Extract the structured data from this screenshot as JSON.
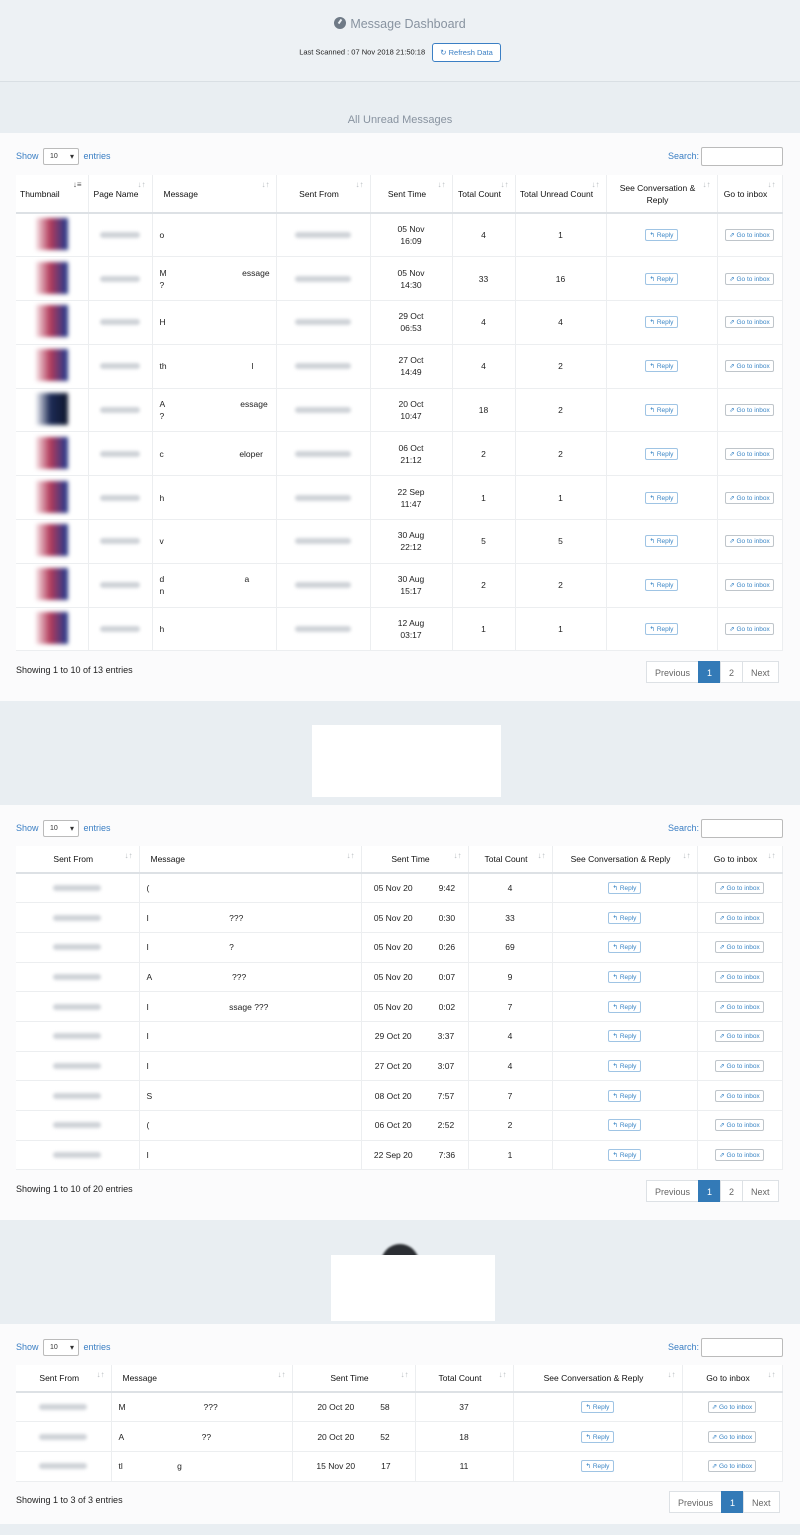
{
  "header": {
    "title": "Message Dashboard",
    "last_scanned": "Last Scanned : 07 Nov 2018 21:50:18",
    "refresh_label": "Refresh Data"
  },
  "section1_title": "All Unread Messages",
  "controls": {
    "show": "Show",
    "entries": "entries",
    "page_length": "10",
    "search_label": "Search:"
  },
  "table1": {
    "headers": [
      "Thumbnail",
      "Page Name",
      "Message",
      "Sent From",
      "Sent Time",
      "Total Count",
      "Total Unread Count",
      "See Conversation & Reply",
      "Go to inbox"
    ],
    "rows": [
      {
        "msg": "o",
        "time": "05 Nov\n16:09",
        "total": "4",
        "unread": "1"
      },
      {
        "msg": "M                                essage\n?",
        "time": "05 Nov\n14:30",
        "total": "33",
        "unread": "16"
      },
      {
        "msg": "H",
        "time": "29 Oct\n06:53",
        "total": "4",
        "unread": "4"
      },
      {
        "msg": "th                                    l",
        "time": "27 Oct\n14:49",
        "total": "4",
        "unread": "2"
      },
      {
        "msg": "A                                essage\n?",
        "time": "20 Oct\n10:47",
        "total": "18",
        "unread": "2"
      },
      {
        "msg": "c                                eloper",
        "time": "06 Oct\n21:12",
        "total": "2",
        "unread": "2"
      },
      {
        "msg": "h",
        "time": "22 Sep\n11:47",
        "total": "1",
        "unread": "1"
      },
      {
        "msg": "v",
        "time": "30 Aug\n22:12",
        "total": "5",
        "unread": "5"
      },
      {
        "msg": "d                                  a\nn",
        "time": "30 Aug\n15:17",
        "total": "2",
        "unread": "2"
      },
      {
        "msg": "h",
        "time": "12 Aug\n03:17",
        "total": "1",
        "unread": "1"
      }
    ],
    "info": "Showing 1 to 10 of 13 entries",
    "pager": [
      "Previous",
      "1",
      "2",
      "Next"
    ]
  },
  "table2": {
    "headers": [
      "Sent From",
      "Message",
      "Sent Time",
      "Total Count",
      "See Conversation & Reply",
      "Go to inbox"
    ],
    "rows": [
      {
        "msg": "(",
        "time_a": "05 Nov 20",
        "time_b": "9:42",
        "total": "4"
      },
      {
        "msg": "I                                  ???",
        "time_a": "05 Nov 20",
        "time_b": "0:30",
        "total": "33"
      },
      {
        "msg": "I                                  ?",
        "time_a": "05 Nov 20",
        "time_b": "0:26",
        "total": "69"
      },
      {
        "msg": "A                                  ???",
        "time_a": "05 Nov 20",
        "time_b": "0:07",
        "total": "9"
      },
      {
        "msg": "I                                  ssage ???",
        "time_a": "05 Nov 20",
        "time_b": "0:02",
        "total": "7"
      },
      {
        "msg": "I",
        "time_a": "29 Oct 20",
        "time_b": "3:37",
        "total": "4"
      },
      {
        "msg": "I",
        "time_a": "27 Oct 20",
        "time_b": "3:07",
        "total": "4"
      },
      {
        "msg": "S",
        "time_a": "08 Oct 20",
        "time_b": "7:57",
        "total": "7"
      },
      {
        "msg": "(",
        "time_a": "06 Oct 20",
        "time_b": "2:52",
        "total": "2"
      },
      {
        "msg": "I",
        "time_a": "22 Sep 20",
        "time_b": "7:36",
        "total": "1"
      }
    ],
    "info": "Showing 1 to 10 of 20 entries",
    "pager": [
      "Previous",
      "1",
      "2",
      "Next"
    ]
  },
  "table3": {
    "headers": [
      "Sent From",
      "Message",
      "Sent Time",
      "Total Count",
      "See Conversation & Reply",
      "Go to inbox"
    ],
    "rows": [
      {
        "msg": "M                                 ???",
        "time_a": "20 Oct 20",
        "time_b": "58",
        "total": "37"
      },
      {
        "msg": "A                                 ??",
        "time_a": "20 Oct 20",
        "time_b": "52",
        "total": "18"
      },
      {
        "msg": "tl                       g",
        "time_a": "15 Nov 20",
        "time_b": "17",
        "total": "11"
      }
    ],
    "info": "Showing 1 to 3 of 3 entries",
    "pager": [
      "Previous",
      "1",
      "Next"
    ]
  },
  "reply_label": "Reply",
  "inbox_label": "Go to inbox",
  "reply_icon": "reply-icon",
  "inbox_icon": "external-link-icon"
}
